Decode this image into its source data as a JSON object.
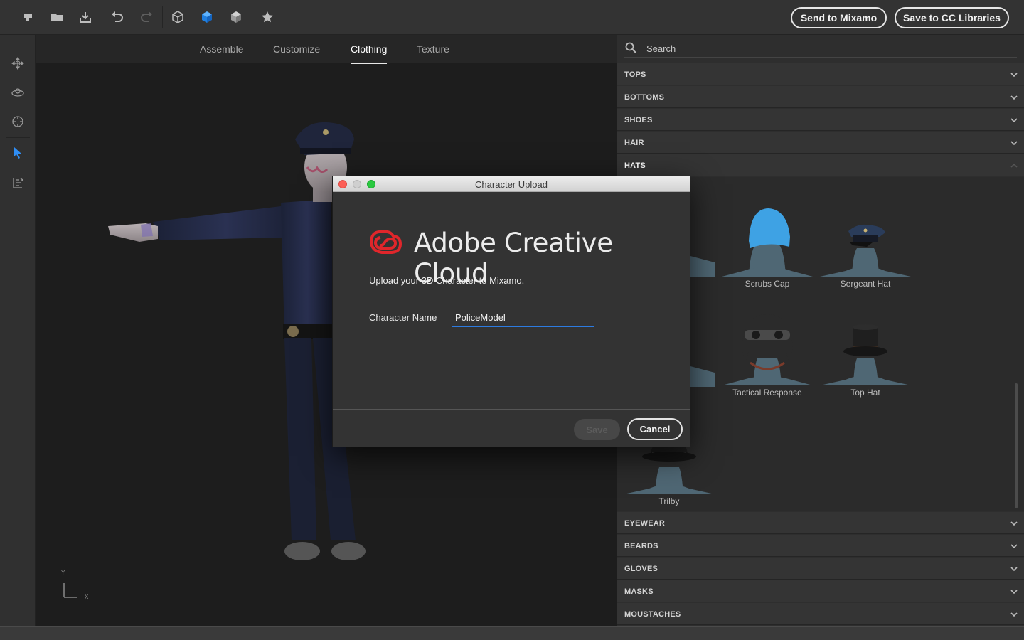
{
  "toolbar": {
    "icons": [
      "mixamo-icon",
      "open-folder-icon",
      "import-icon",
      "undo-icon",
      "redo-icon",
      "cube-outline-icon",
      "cube-solid-icon",
      "cube-shaded-icon",
      "star-icon"
    ],
    "send_button": "Send to Mixamo",
    "save_button": "Save to CC Libraries"
  },
  "left_rail": {
    "icons": [
      "move-icon",
      "orbit-icon",
      "target-icon",
      "select-arrow-icon",
      "pose-icon"
    ]
  },
  "tabs": [
    {
      "label": "Assemble",
      "active": false
    },
    {
      "label": "Customize",
      "active": false
    },
    {
      "label": "Clothing",
      "active": true
    },
    {
      "label": "Texture",
      "active": false
    }
  ],
  "viewport": {
    "axis_y": "Y",
    "axis_x": "X"
  },
  "right_panel": {
    "search_placeholder": "Search",
    "categories_top": [
      "TOPS",
      "BOTTOMS",
      "SHOES",
      "HAIR",
      "HATS"
    ],
    "hats": [
      {
        "name": "Scrubs Cap"
      },
      {
        "name": "Sergeant Hat"
      },
      {
        "name": "Tactical Response"
      },
      {
        "name": "Top Hat"
      },
      {
        "name": "Trilby"
      }
    ],
    "categories_bottom": [
      "EYEWEAR",
      "BEARDS",
      "GLOVES",
      "MASKS",
      "MOUSTACHES"
    ]
  },
  "modal": {
    "title": "Character Upload",
    "brand": "Adobe Creative Cloud",
    "upload_text": "Upload your 3D Character to Mixamo.",
    "name_label": "Character Name",
    "name_value": "PoliceModel",
    "save_label": "Save",
    "cancel_label": "Cancel"
  },
  "colors": {
    "accent_blue": "#2d7be0",
    "cc_red": "#e0262b",
    "close": "#fc5f57",
    "maximize": "#2ac940"
  }
}
